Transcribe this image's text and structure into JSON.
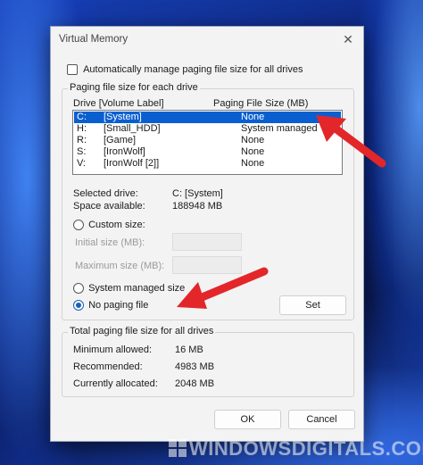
{
  "window": {
    "title": "Virtual Memory",
    "close_glyph": "✕"
  },
  "auto_manage": {
    "label": "Automatically manage paging file size for all drives",
    "checked": false
  },
  "paging_group": {
    "label": "Paging file size for each drive",
    "col_drive": "Drive  [Volume Label]",
    "col_size": "Paging File Size (MB)",
    "rows": [
      {
        "drive": "C:",
        "label": "[System]",
        "size": "None",
        "selected": true
      },
      {
        "drive": "H:",
        "label": "[Small_HDD]",
        "size": "System managed",
        "selected": false
      },
      {
        "drive": "R:",
        "label": "[Game]",
        "size": "None",
        "selected": false
      },
      {
        "drive": "S:",
        "label": "[IronWolf]",
        "size": "None",
        "selected": false
      },
      {
        "drive": "V:",
        "label": "[IronWolf [2]]",
        "size": "None",
        "selected": false
      }
    ],
    "selected_drive_label": "Selected drive:",
    "selected_drive_value": "C:  [System]",
    "space_available_label": "Space available:",
    "space_available_value": "188948 MB",
    "custom_size_label": "Custom size:",
    "initial_size_label": "Initial size (MB):",
    "maximum_size_label": "Maximum size (MB):",
    "system_managed_label": "System managed size",
    "no_paging_label": "No paging file",
    "selected_option": "no_paging",
    "set_label": "Set"
  },
  "total_group": {
    "label": "Total paging file size for all drives",
    "min_label": "Minimum allowed:",
    "min_value": "16 MB",
    "rec_label": "Recommended:",
    "rec_value": "4983 MB",
    "cur_label": "Currently allocated:",
    "cur_value": "2048 MB"
  },
  "buttons": {
    "ok": "OK",
    "cancel": "Cancel"
  },
  "watermark": {
    "text": "WINDOWSDIGITALS.COM"
  },
  "colors": {
    "accent": "#0a5fd0",
    "annotation_arrow": "#e3262a"
  }
}
